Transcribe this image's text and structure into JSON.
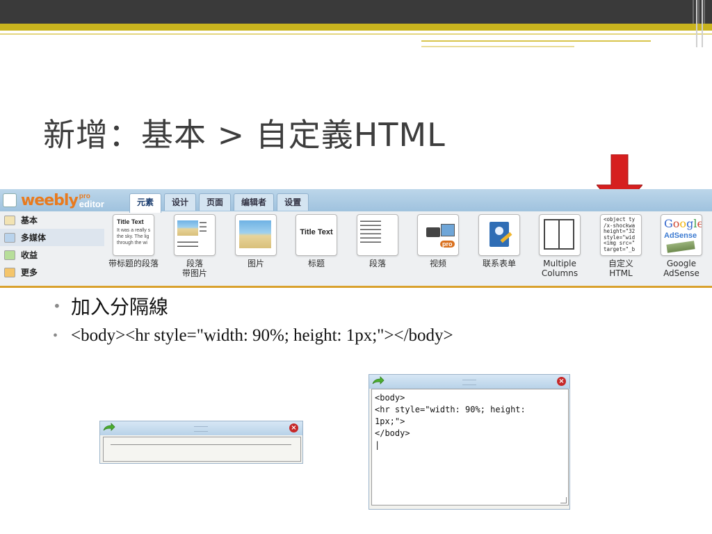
{
  "slide": {
    "title": "新增：基本 > 自定義HTML",
    "bullets": [
      "加入分隔線",
      "<body><hr style=\"width: 90%; height: 1px;\"></body>"
    ]
  },
  "editor": {
    "logo": {
      "name": "weebly",
      "pro": "pro",
      "editor": "editor"
    },
    "tabs": [
      "元素",
      "设计",
      "页面",
      "编辑者",
      "设置"
    ],
    "sidebar": [
      "基本",
      "多媒体",
      "收益",
      "更多"
    ],
    "elements": [
      {
        "label": "带标题的段落",
        "icon": "title-paragraph-icon",
        "sample_title": "Title Text",
        "sample_body": "It was a really s the sky. The lig through the wi"
      },
      {
        "label": "段落\n带图片",
        "icon": "paragraph-with-image-icon"
      },
      {
        "label": "图片",
        "icon": "image-icon"
      },
      {
        "label": "标题",
        "icon": "title-icon",
        "sample_title": "Title Text"
      },
      {
        "label": "段落",
        "icon": "paragraph-icon"
      },
      {
        "label": "视频",
        "icon": "video-icon",
        "badge": "pro"
      },
      {
        "label": "联系表单",
        "icon": "contact-form-icon"
      },
      {
        "label": "Multiple\nColumns",
        "icon": "multiple-columns-icon"
      },
      {
        "label": "自定义\nHTML",
        "icon": "custom-html-icon",
        "code": "<object ty\n/x-shockwa\nheight=\"32\nstyle=\"wid\n<img src=\"\ntarget=\"_b"
      },
      {
        "label": "Google\nAdSense",
        "icon": "google-adsense-icon",
        "google": "Google",
        "adsense": "AdSense"
      }
    ]
  },
  "dialog_code": {
    "text": "<body>\n<hr style=\"width: 90%; height:\n1px;\">\n</body>\n|"
  },
  "colors": {
    "topbar": "#3a3a3a",
    "gold": "#c9b41e",
    "editor_border": "#d9a12d",
    "arrow": "#d61f1f"
  }
}
